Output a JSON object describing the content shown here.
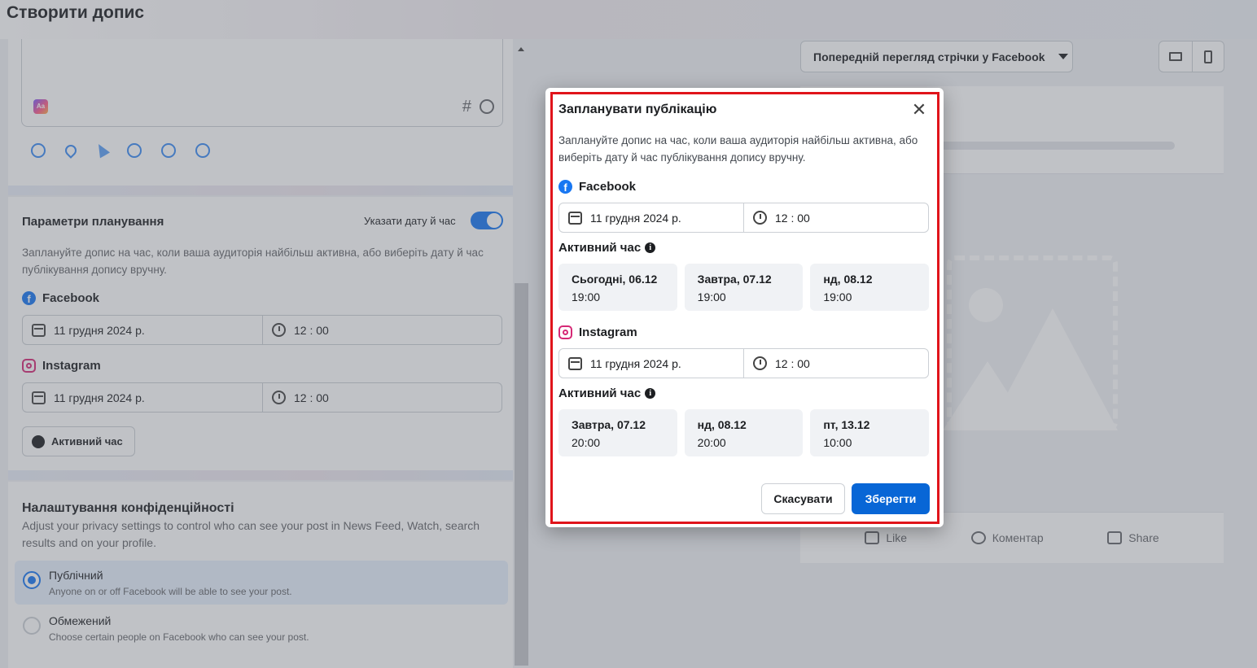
{
  "page": {
    "title": "Створити допис"
  },
  "schedule": {
    "title": "Параметри планування",
    "toggle_label": "Указати дату й час",
    "description": "Заплануйте допис на час, коли ваша аудиторія найбільш активна, або виберіть дату й час публікування допису вручну.",
    "facebook": {
      "label": "Facebook",
      "date": "11 грудня 2024 р.",
      "time": "12 : 00"
    },
    "instagram": {
      "label": "Instagram",
      "date": "11 грудня 2024 р.",
      "time": "12 : 00"
    },
    "active_button": "Активний час"
  },
  "privacy": {
    "title": "Налаштування конфіденційності",
    "description": "Adjust your privacy settings to control who can see your post in News Feed, Watch, search results and on your profile.",
    "options": [
      {
        "name": "Публічний",
        "desc": "Anyone on or off Facebook will be able to see your post.",
        "selected": true
      },
      {
        "name": "Обмежений",
        "desc": "Choose certain people on Facebook who can see your post.",
        "selected": false
      }
    ]
  },
  "preview": {
    "select_label": "Попередній перегляд стрічки у Facebook",
    "actions": {
      "like": "Like",
      "comment": "Коментар",
      "share": "Share"
    }
  },
  "modal": {
    "title": "Запланувати публікацію",
    "close_glyph": "✕",
    "description": "Заплануйте допис на час, коли ваша аудиторія найбільш активна, або виберіть дату й час публікування допису вручну.",
    "facebook": {
      "label": "Facebook",
      "date": "11 грудня 2024 р.",
      "time": "12 : 00",
      "active_title": "Активний час",
      "slots": [
        {
          "day": "Сьогодні, 06.12",
          "time": "19:00"
        },
        {
          "day": "Завтра, 07.12",
          "time": "19:00"
        },
        {
          "day": "нд, 08.12",
          "time": "19:00"
        }
      ]
    },
    "instagram": {
      "label": "Instagram",
      "date": "11 грудня 2024 р.",
      "time": "12 : 00",
      "active_title": "Активний час",
      "slots": [
        {
          "day": "Завтра, 07.12",
          "time": "20:00"
        },
        {
          "day": "нд, 08.12",
          "time": "20:00"
        },
        {
          "day": "пт, 13.12",
          "time": "10:00"
        }
      ]
    },
    "cancel_label": "Скасувати",
    "save_label": "Зберегти"
  },
  "colors": {
    "accent": "#1877f2",
    "save": "#0866d6",
    "highlight": "#e0141b"
  },
  "icons": {
    "facebook": "facebook-icon",
    "instagram": "instagram-icon",
    "calendar": "calendar-icon",
    "clock": "clock-icon",
    "info": "info-icon",
    "close": "close-icon"
  }
}
